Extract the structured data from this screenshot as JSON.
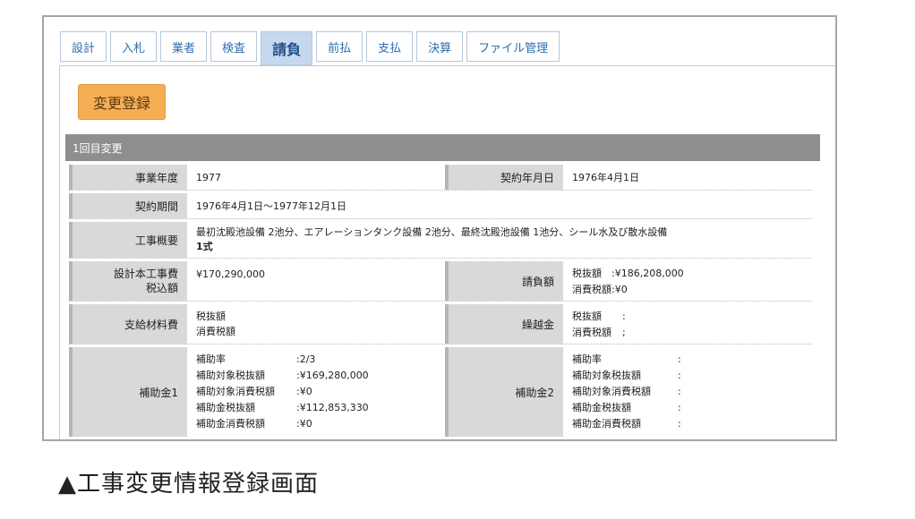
{
  "tabs": [
    {
      "label": "設計",
      "active": false
    },
    {
      "label": "入札",
      "active": false
    },
    {
      "label": "業者",
      "active": false
    },
    {
      "label": "検査",
      "active": false
    },
    {
      "label": "請負",
      "active": true
    },
    {
      "label": "前払",
      "active": false
    },
    {
      "label": "支払",
      "active": false
    },
    {
      "label": "決算",
      "active": false
    },
    {
      "label": "ファイル管理",
      "active": false
    }
  ],
  "button": {
    "label": "変更登録"
  },
  "section": {
    "title": "1回目変更"
  },
  "fields": {
    "fiscal_year": {
      "label": "事業年度",
      "value": "1977"
    },
    "contract_date": {
      "label": "契約年月日",
      "value": "1976年4月1日"
    },
    "contract_period": {
      "label": "契約期間",
      "value": "1976年4月1日〜1977年12月1日"
    },
    "work_summary": {
      "label": "工事概要",
      "value_line1": "最初沈殿池設備 2池分、エアレーションタンク設備 2池分、最終沈殿池設備 1池分、シール水及び散水設備",
      "value_line2": "1式"
    },
    "design_cost": {
      "label_line1": "設計本工事費",
      "label_line2": "税込額",
      "value": "¥170,290,000"
    },
    "contract_amount": {
      "label": "請負額",
      "line1_key": "税抜額",
      "line1_val": ":¥186,208,000",
      "line2_key": "消費税額",
      "line2_val": ":¥0"
    },
    "supplied_material": {
      "label": "支給材料費",
      "line1": "税抜額",
      "line2": "消費税額"
    },
    "carryover": {
      "label": "繰越金",
      "line1_key": "税抜額",
      "line1_val": ":",
      "line2_key": "消費税額",
      "line2_val": ";"
    },
    "subsidy1": {
      "label": "補助金1",
      "rows": [
        {
          "k": "補助率",
          "v": ":2/3"
        },
        {
          "k": "補助対象税抜額",
          "v": ":¥169,280,000"
        },
        {
          "k": "補助対象消費税額",
          "v": ":¥0"
        },
        {
          "k": "補助金税抜額",
          "v": ":¥112,853,330"
        },
        {
          "k": "補助金消費税額",
          "v": ":¥0"
        }
      ]
    },
    "subsidy2": {
      "label": "補助金2",
      "rows": [
        {
          "k": "補助率",
          "v": ":"
        },
        {
          "k": "補助対象税抜額",
          "v": ":"
        },
        {
          "k": "補助対象消費税額",
          "v": ":"
        },
        {
          "k": "補助金税抜額",
          "v": ":"
        },
        {
          "k": "補助金消費税額",
          "v": ":"
        }
      ]
    }
  },
  "caption": {
    "text": "▲工事変更情報登録画面"
  },
  "colors": {
    "button": "#f6ae55",
    "section_bar": "#8e8e8e",
    "active_tab": "#c6d8ee",
    "tab_text": "#2e6db0"
  }
}
